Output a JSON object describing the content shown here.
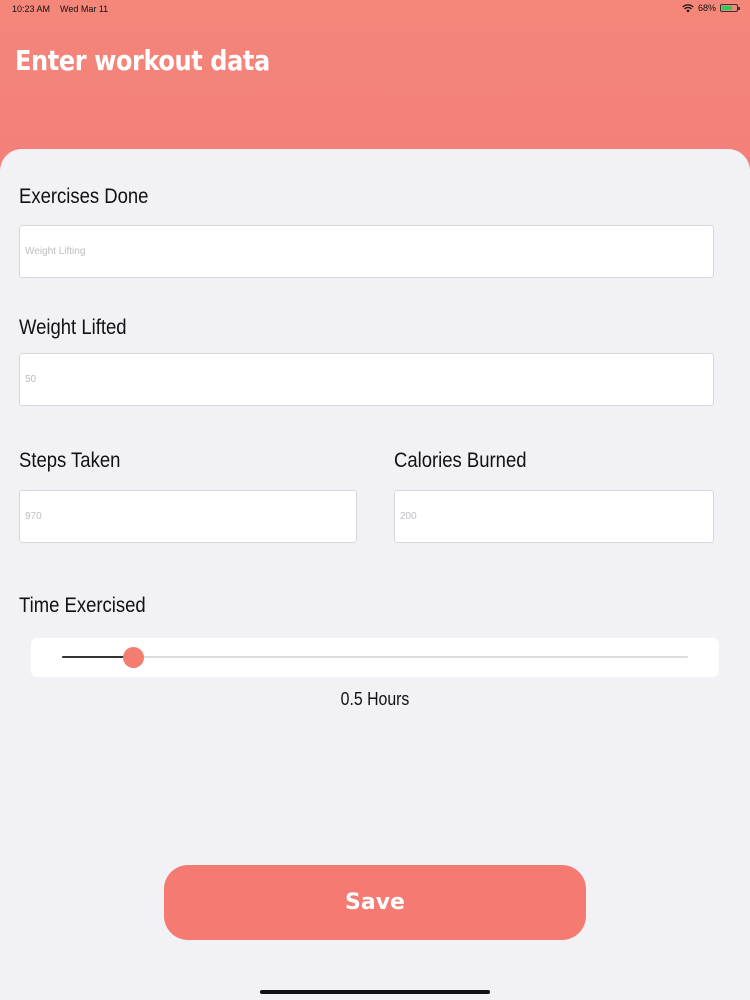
{
  "status_bar": {
    "time": "10:23 AM",
    "date": "Wed Mar 11",
    "battery": "68%",
    "battery_level": 0.68
  },
  "header": {
    "title": "Enter workout data"
  },
  "form": {
    "exercises": {
      "label": "Exercises Done",
      "placeholder": "Weight Lifting",
      "value": ""
    },
    "weight": {
      "label": "Weight Lifted",
      "placeholder": "50",
      "value": ""
    },
    "steps": {
      "label": "Steps Taken",
      "placeholder": "970",
      "value": ""
    },
    "calories": {
      "label": "Calories Burned",
      "placeholder": "200",
      "value": ""
    },
    "time": {
      "label": "Time Exercised",
      "value_text": "0.5 Hours",
      "slider_fraction": 0.113
    }
  },
  "actions": {
    "save_label": "Save"
  },
  "colors": {
    "accent": "#F47A72",
    "header": "#F4847A",
    "background": "#F2F2F6"
  }
}
